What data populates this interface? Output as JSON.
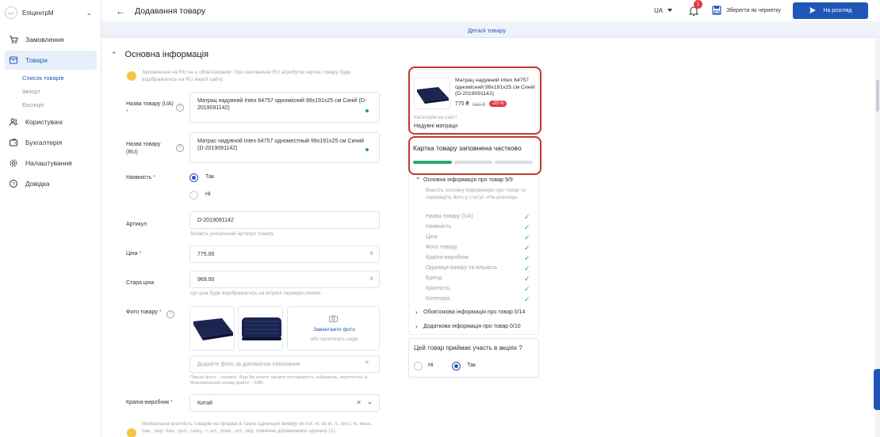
{
  "sidebar": {
    "store_logo": "logo",
    "store_name": "ЕпіцентрМ",
    "items": [
      {
        "label": "Замовлення",
        "icon": "cart-icon"
      },
      {
        "label": "Товари",
        "icon": "box-icon"
      },
      {
        "label": "Користувачі",
        "icon": "users-icon"
      },
      {
        "label": "Бухгалтерія",
        "icon": "wallet-icon"
      },
      {
        "label": "Налаштування",
        "icon": "gear-icon"
      },
      {
        "label": "Довідка",
        "icon": "help-icon"
      }
    ],
    "subitems": [
      "Список товарів",
      "Імпорт",
      "Експорт"
    ]
  },
  "header": {
    "title": "Додавання товару",
    "lang": "UA",
    "notifications": "1",
    "draft_label": "Зберегти як чернетку",
    "review_label": "На розгляд"
  },
  "tabs": {
    "details": "Деталі товару"
  },
  "form": {
    "section_title": "Основна інформація",
    "ru_hint": "Заповнення на RU не є обов'язковим. При заповненні RU атрибутів картка товару буде відображатись на RU версії сайту.",
    "name_ua_label": "Назва товару (UA)",
    "name_ua_value": "Матрац надувний Intex 64757 одномісний 99x191x25 см Синій (D-2019091142)",
    "name_ru_label": "Назва товару (RU)",
    "name_ru_value": "Матрас надувной Intex 64757 одноместный 99x191x25 см Синий (D-2019091142)",
    "availability_label": "Наявність",
    "availability_yes": "Так",
    "availability_no": "Ні",
    "sku_label": "Артикул",
    "sku_value": "D-2019091142",
    "sku_hint": "Вкажіть унікальний артикул товару",
    "price_label": "Ціна",
    "price_value": "775.00",
    "currency": "₴",
    "old_price_label": "Стара ціна",
    "old_price_value": "969.00",
    "old_price_hint": "Ця ціна буде відображатись на вітрині перекресленою",
    "photo_label": "Фото товару",
    "upload_label": "Завантажте фото",
    "upload_hint": "або перетягніть сюди",
    "photo_url_placeholder": "Додайте фото за допомогою посилання",
    "photo_hint": "Перше фото – головне. Ящо Ви хочете змінити послідовність зображень, перетягніть їх. Максимальний розмір файлу – 5Мб.",
    "country_label": "Країна-виробник",
    "country_value": "Китай",
    "multiplicity_hint": "Мінімальна кратність товарів на продаж в таких одиницях виміру як пог, кг, кв.м, л, лист, м, меш., пак., пар, пач., рул., секц., т, шт., упак., шт., мід. повинна дорівнювати одиниці (1)."
  },
  "preview": {
    "title": "Матрац надувний Intex 64757 одномісний 99x191x25 см Синій (D-2019091142)",
    "price": "775 ₴",
    "old_price": "969 ₴",
    "discount": "-20 %",
    "category_caption": "Категорія на сайті",
    "category": "Надувні матраци"
  },
  "completeness": {
    "title": "Картка товару заповнена частково",
    "progress_segments": [
      1,
      0,
      0
    ],
    "main_group": "Основна інформація про товар 9/9",
    "main_hint": "Внесіть основну інформацію про товар та переведіть його у статус «На розгляд».",
    "items": [
      "Назва товару (UA)",
      "Наявність",
      "Ціна",
      "Фото товару",
      "Країна-виробник",
      "Одиниця виміру та кількість",
      "Бренд",
      "Кратність",
      "Категорія"
    ],
    "required_group": "Обов'язкова інформація про товар 0/14",
    "extra_group": "Додаткова інформація про товар 0/10"
  },
  "promo": {
    "question": "Цей товар приймає участь в акціях ?",
    "no": "Ні",
    "yes": "Так"
  }
}
